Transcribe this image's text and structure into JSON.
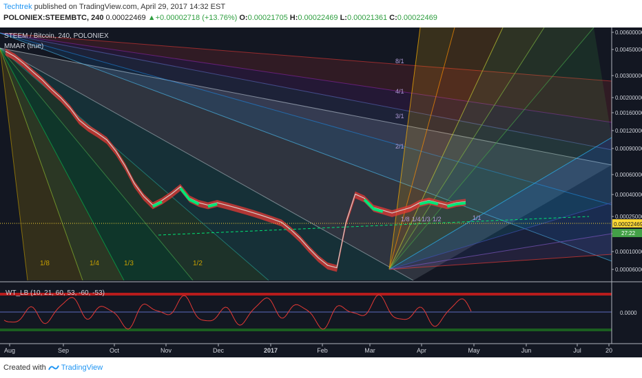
{
  "header": {
    "author": "Techtrek",
    "published_text": " published on TradingView.com, April 29, 2017 14:32 EST",
    "symbol": "POLONIEX:STEEMBTC, 240",
    "price": "0.00022469",
    "change": "+0.00002718 (+13.76%)",
    "open_label": "O:",
    "open": "0.00021705",
    "high_label": "H:",
    "high": "0.00022469",
    "low_label": "L:",
    "low": "0.00021361",
    "close_label": "C:",
    "close": "0.00022469"
  },
  "footer": {
    "created_with": "Created with",
    "brand": "TradingView"
  },
  "chart_data": {
    "type": "line",
    "title": "STEEM / Bitcoin, 240, POLONIEX",
    "indicator_label": "MMAR (true)",
    "oscillator_label": "WT_LB (10, 21, 60, 53, -60, -53)",
    "oscillator_zero": "0.0000",
    "x_tick_labels": [
      "Aug",
      "Sep",
      "Oct",
      "Nov",
      "Dec",
      "2017",
      "Feb",
      "Mar",
      "Apr",
      "May",
      "Jun",
      "Jul",
      "20"
    ],
    "y_tick_labels": [
      "0.00600000",
      "0.00450000",
      "0.00300000",
      "0.00200000",
      "0.00160000",
      "0.00120000",
      "0.00090000",
      "0.00060000",
      "0.00040000",
      "0.00025000",
      "0.00022469",
      "0.00015000",
      "0.00010000",
      "0.00006000"
    ],
    "price_tag": "0.00022469",
    "countdown_tag": "27:22",
    "fan_labels_left": [
      "1/8",
      "1/4",
      "1/3",
      "1/2"
    ],
    "fan_labels_right": [
      "8/1",
      "4/1",
      "3/1",
      "2/1",
      "1/8",
      "1/4",
      "1/3",
      "1/2",
      "1/1"
    ],
    "series": [
      {
        "values_x": [
          0,
          2,
          4,
          6,
          8,
          10,
          12,
          14,
          16,
          18,
          20,
          22,
          24,
          26,
          28,
          30,
          32,
          34,
          36,
          38,
          40,
          42,
          44,
          46,
          48,
          50,
          52,
          54,
          56,
          58,
          60,
          62,
          64,
          66,
          68,
          70,
          72,
          74,
          76,
          78,
          80,
          82,
          84,
          86,
          88,
          90,
          92,
          94,
          96,
          98,
          100
        ],
        "values_y": [
          0.0042,
          0.0038,
          0.0033,
          0.0028,
          0.0024,
          0.002,
          0.0017,
          0.0014,
          0.0011,
          0.00095,
          0.00085,
          0.00075,
          0.0006,
          0.00045,
          0.00032,
          0.00025,
          0.00021,
          0.00023,
          0.00026,
          0.0003,
          0.00024,
          0.00022,
          0.00021,
          0.00022,
          0.00021,
          0.0002,
          0.00019,
          0.00018,
          0.00017,
          0.00016,
          0.00015,
          0.00013,
          0.00011,
          9e-05,
          7.5e-05,
          6.5e-05,
          6.2e-05,
          0.00015,
          0.00026,
          0.00024,
          0.0002,
          0.00019,
          0.00018,
          0.00019,
          0.0002,
          0.00022,
          0.00023,
          0.00022,
          0.00021,
          0.00022,
          0.00022469
        ]
      }
    ]
  }
}
